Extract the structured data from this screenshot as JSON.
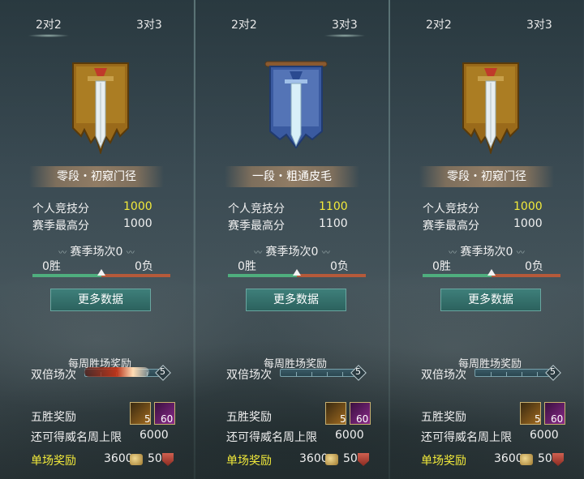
{
  "colors": {
    "highlight_yellow": "#f2ea3a",
    "win_green": "#4fae7e",
    "loss_red": "#b55a3a",
    "button_teal": "#3e7f7a"
  },
  "panels": [
    {
      "tabs": [
        "2对2",
        "3对3"
      ],
      "active_tab": 0,
      "banner_icon": "gold-sword-banner-icon",
      "rank": "零段・初窥门径",
      "personal_label": "个人竞技分",
      "personal_value": "1000",
      "season_high_label": "赛季最高分",
      "season_high_value": "1000",
      "season_games": "赛季场次0",
      "wins": "0胜",
      "losses": "0负",
      "win_ratio": 0.5,
      "more_button": "更多数据",
      "weekly_title": "每周胜场奖励",
      "double_label": "双倍场次",
      "double_count": "5",
      "five_win_label": "五胜奖励",
      "item1_count": "5",
      "item2_count": "60",
      "fame_cap_label": "还可得威名周上限",
      "fame_cap_value": "6000",
      "single_label": "单场奖励",
      "single_coin": "3600",
      "single_shield": "50"
    },
    {
      "tabs": [
        "2对2",
        "3对3"
      ],
      "active_tab": 1,
      "banner_icon": "blue-sword-banner-icon",
      "rank": "一段・粗通皮毛",
      "personal_label": "个人竞技分",
      "personal_value": "1100",
      "season_high_label": "赛季最高分",
      "season_high_value": "1100",
      "season_games": "赛季场次0",
      "wins": "0胜",
      "losses": "0负",
      "win_ratio": 0.5,
      "more_button": "更多数据",
      "weekly_title": "每周胜场奖励",
      "double_label": "双倍场次",
      "double_count": "5",
      "five_win_label": "五胜奖励",
      "item1_count": "5",
      "item2_count": "60",
      "fame_cap_label": "还可得威名周上限",
      "fame_cap_value": "6000",
      "single_label": "单场奖励",
      "single_coin": "3600",
      "single_shield": "50"
    },
    {
      "tabs": [
        "2对2",
        "3对3"
      ],
      "active_tab": -1,
      "banner_icon": "gold-sword-banner-icon",
      "rank": "零段・初窥门径",
      "personal_label": "个人竞技分",
      "personal_value": "1000",
      "season_high_label": "赛季最高分",
      "season_high_value": "1000",
      "season_games": "赛季场次0",
      "wins": "0胜",
      "losses": "0负",
      "win_ratio": 0.5,
      "more_button": "更多数据",
      "weekly_title": "每周胜场奖励",
      "double_label": "双倍场次",
      "double_count": "5",
      "five_win_label": "五胜奖励",
      "item1_count": "5",
      "item2_count": "60",
      "fame_cap_label": "还可得威名周上限",
      "fame_cap_value": "6000",
      "single_label": "单场奖励",
      "single_coin": "3600",
      "single_shield": "50"
    }
  ]
}
